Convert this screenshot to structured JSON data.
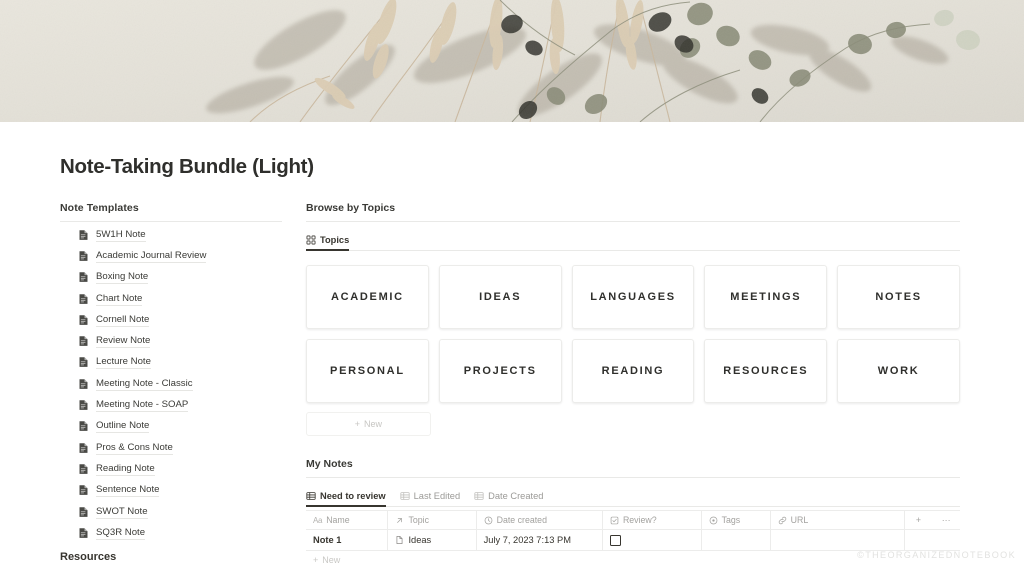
{
  "hero": {
    "alt": "dried-botanical-shadows-on-beige-wall"
  },
  "page_title": "Note-Taking Bundle (Light)",
  "left": {
    "templates_heading": "Note Templates",
    "templates": [
      {
        "label": "5W1H Note",
        "icon": "document-icon"
      },
      {
        "label": "Academic Journal Review",
        "icon": "document-icon"
      },
      {
        "label": "Boxing Note",
        "icon": "document-icon"
      },
      {
        "label": "Chart Note",
        "icon": "document-icon"
      },
      {
        "label": "Cornell Note",
        "icon": "document-icon"
      },
      {
        "label": "Review Note",
        "icon": "document-icon"
      },
      {
        "label": "Lecture Note",
        "icon": "document-icon"
      },
      {
        "label": "Meeting Note - Classic",
        "icon": "document-icon"
      },
      {
        "label": "Meeting Note - SOAP",
        "icon": "document-icon"
      },
      {
        "label": "Outline Note",
        "icon": "document-icon"
      },
      {
        "label": "Pros & Cons Note",
        "icon": "document-icon"
      },
      {
        "label": "Reading Note",
        "icon": "document-icon"
      },
      {
        "label": "Sentence Note",
        "icon": "document-icon"
      },
      {
        "label": "SWOT Note",
        "icon": "document-icon"
      },
      {
        "label": "SQ3R Note",
        "icon": "document-icon"
      }
    ],
    "resources_heading": "Resources"
  },
  "browse": {
    "heading": "Browse by Topics",
    "tabs": [
      {
        "label": "Topics",
        "icon": "gallery-grid-icon",
        "active": true
      }
    ],
    "topics": [
      "ACADEMIC",
      "IDEAS",
      "LANGUAGES",
      "MEETINGS",
      "NOTES",
      "PERSONAL",
      "PROJECTS",
      "READING",
      "RESOURCES",
      "WORK"
    ],
    "new_label": "New"
  },
  "my_notes": {
    "heading": "My Notes",
    "tabs": [
      {
        "label": "Need to review",
        "icon": "table-icon",
        "active": true
      },
      {
        "label": "Last Edited",
        "icon": "table-icon",
        "active": false
      },
      {
        "label": "Date Created",
        "icon": "table-icon",
        "active": false
      }
    ],
    "columns": [
      {
        "label": "Name",
        "icon": "aa-text-icon"
      },
      {
        "label": "Topic",
        "icon": "relation-arrow-icon"
      },
      {
        "label": "Date created",
        "icon": "clock-icon"
      },
      {
        "label": "Review?",
        "icon": "checkbox-icon"
      },
      {
        "label": "Tags",
        "icon": "select-circle-icon"
      },
      {
        "label": "URL",
        "icon": "link-icon"
      }
    ],
    "add_column_label": "+",
    "more_label": "···",
    "rows": [
      {
        "name": "Note 1",
        "topic": "Ideas",
        "topic_icon": "page-icon",
        "date_created": "July 7, 2023 7:13 PM",
        "review": false,
        "tags": "",
        "url": ""
      }
    ],
    "new_row_label": "New"
  },
  "watermark": "©THEORGANIZEDNOTEBOOK",
  "colors": {
    "text": "#37352f",
    "muted": "#9b9a97",
    "border": "#ececeb",
    "hero_bg": "#e7e3da"
  }
}
